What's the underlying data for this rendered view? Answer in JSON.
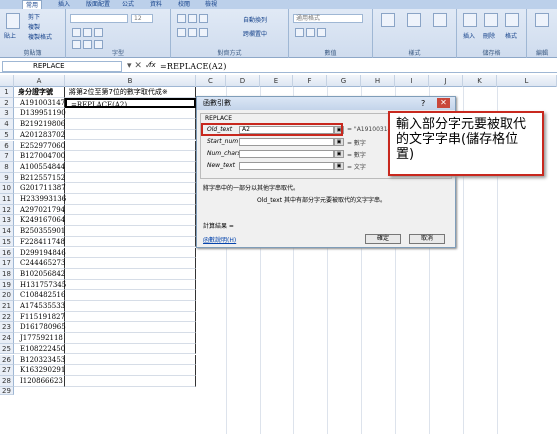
{
  "ribbon": {
    "tabs": [
      "常用",
      "插入",
      "版面配置",
      "公式",
      "資料",
      "校閱",
      "檢視"
    ],
    "clipboard": {
      "paste": "貼上",
      "cut": "剪下",
      "copy": "複製",
      "format_painter": "複製格式",
      "group": "剪貼簿"
    },
    "font": {
      "size": "12",
      "group": "字型"
    },
    "alignment": {
      "wrap": "自動換列",
      "merge": "跨欄置中",
      "group": "對齊方式"
    },
    "number": {
      "format": "通用格式",
      "group": "數值"
    },
    "styles": {
      "cond": "設定格式化的條件",
      "table": "格式化為表格",
      "cell": "儲存格樣式",
      "group": "樣式"
    },
    "cells": {
      "insert": "插入",
      "delete": "刪除",
      "format": "格式",
      "group": "儲存格"
    },
    "editing": {
      "group": "編輯"
    }
  },
  "formula_bar": {
    "name_box": "REPLACE",
    "formula": "=REPLACE(A2)",
    "fx": "fx"
  },
  "columns": [
    "A",
    "B",
    "C",
    "D",
    "E",
    "F",
    "G",
    "H",
    "I",
    "J",
    "K",
    "L"
  ],
  "sheet": {
    "header_a": "身分證字號",
    "header_b": "將第2位至第7位的數字取代成※",
    "b2": "=REPLACE(A2)",
    "ids": [
      "A191003147",
      "D139951190",
      "B219219806",
      "A201283702",
      "E252977060",
      "B127004700",
      "A100554844",
      "B212557152",
      "G201711387",
      "H233993136",
      "A297021794",
      "K249167064",
      "B250355901",
      "F228411748",
      "D299194846",
      "C244465273",
      "B102056842",
      "H131757345",
      "C108482516",
      "A174535533",
      "F115191827",
      "D161780965",
      "J177592118",
      "E108222450",
      "B120323453",
      "K163290291",
      "I120866623"
    ]
  },
  "dialog": {
    "title": "函數引數",
    "func": "REPLACE",
    "args": [
      {
        "name": "Old_text",
        "value": "A2",
        "result": "= \"A191003147\""
      },
      {
        "name": "Start_num",
        "value": "",
        "result": "= 數字"
      },
      {
        "name": "Num_chars",
        "value": "",
        "result": "= 數字"
      },
      {
        "name": "New_text",
        "value": "",
        "result": "= 文字"
      }
    ],
    "desc": "將字串中的一部分以其他字串取代。",
    "arg_desc": "Old_text  其中有部分字元要被取代的文字字串。",
    "calc": "計算結果 =",
    "help": "函數說明(H)",
    "ok": "確定",
    "cancel": "取消"
  },
  "callout": {
    "text": "輸入部分字元要被取代的文字字串(儲存格位置)"
  }
}
